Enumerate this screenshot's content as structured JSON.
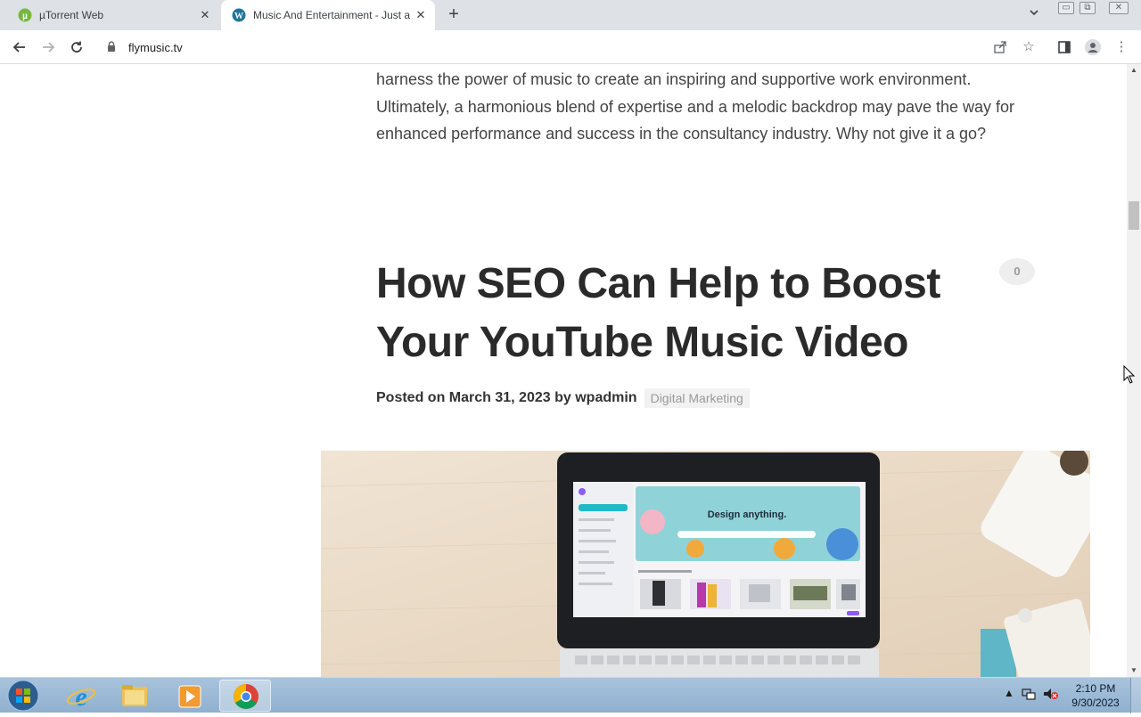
{
  "browser": {
    "tabs": [
      {
        "title": "µTorrent Web",
        "active": false
      },
      {
        "title": "Music And Entertainment - Just a",
        "active": true
      }
    ],
    "url": "flymusic.tv"
  },
  "article": {
    "intro": "harness the power of music to create an inspiring and supportive work environment. Ultimately, a harmonious blend of expertise and a melodic backdrop may pave the way for enhanced performance and success in the consultancy industry. Why not give it a go?",
    "post_title": "How SEO Can Help to Boost Your YouTube Music Video",
    "comment_count": "0",
    "meta": {
      "posted_on": "Posted on",
      "date": "March 31, 2023",
      "by": "by",
      "author": "wpadmin",
      "category": "Digital Marketing"
    },
    "hero_screen_text": "Design anything."
  },
  "taskbar": {
    "time": "2:10 PM",
    "date": "9/30/2023"
  },
  "colors": {
    "tabstrip": "#dee1e6",
    "taskbar": "#9bb8d6",
    "utorrent": "#76b83f",
    "wordpress": "#21759b"
  }
}
